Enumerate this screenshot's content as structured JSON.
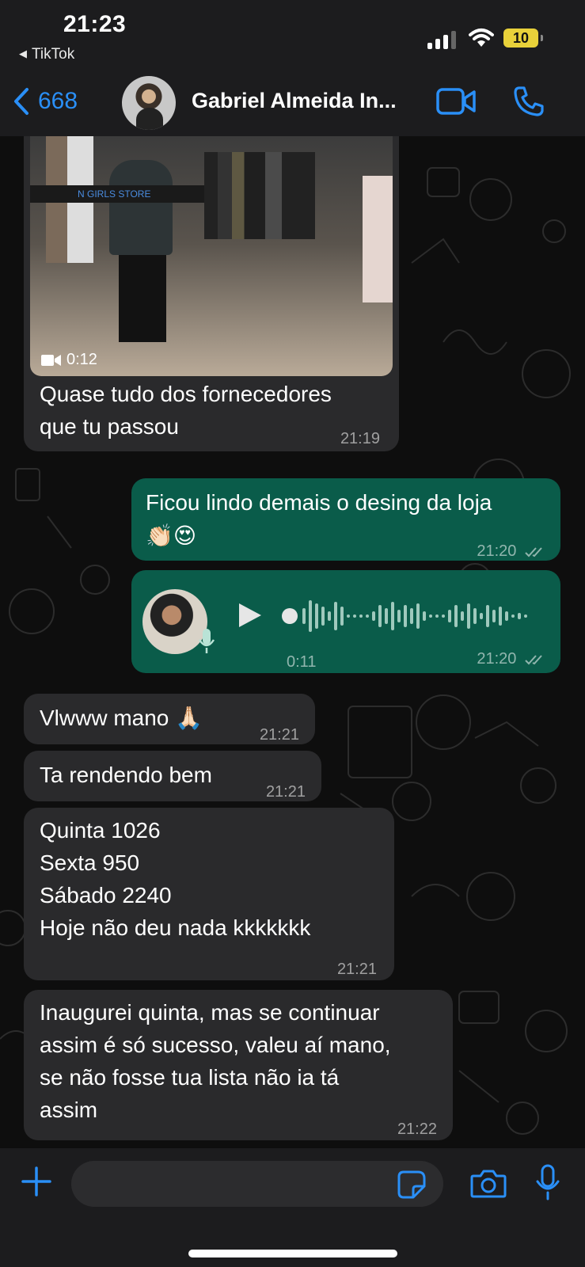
{
  "status_bar": {
    "time": "21:23",
    "back_app": "TikTok",
    "battery": "10"
  },
  "header": {
    "back_count": "668",
    "contact_name": "Gabriel Almeida In..."
  },
  "messages": [
    {
      "type": "video",
      "direction": "incoming",
      "video_duration": "0:12",
      "video_store_sign": "N GIRLS STORE",
      "caption": "Quase tudo dos fornecedores que tu passou",
      "caption_line1": "Quase tudo dos fornecedores",
      "caption_line2": "que tu passou",
      "time": "21:19"
    },
    {
      "type": "text",
      "direction": "outgoing",
      "line1": "Ficou lindo demais o desing da loja",
      "line2": "👏🏻😍",
      "time": "21:20",
      "status": "read"
    },
    {
      "type": "audio",
      "direction": "outgoing",
      "duration": "0:11",
      "time": "21:20",
      "status": "read"
    },
    {
      "type": "text",
      "direction": "incoming",
      "text": "Vlwww mano 🙏🏻",
      "time": "21:21"
    },
    {
      "type": "text",
      "direction": "incoming",
      "text": "Ta rendendo bem",
      "time": "21:21"
    },
    {
      "type": "text",
      "direction": "incoming",
      "lines": [
        "Quinta 1026",
        "Sexta 950",
        "Sábado 2240",
        "Hoje não deu nada kkkkkkk"
      ],
      "time": "21:21"
    },
    {
      "type": "text",
      "direction": "incoming",
      "lines": [
        "Inaugurei quinta, mas se continuar",
        "assim é só sucesso, valeu aí mano,",
        "se não fosse tua lista não ia tá",
        "assim"
      ],
      "time": "21:22"
    }
  ],
  "composer": {
    "input_value": "",
    "input_placeholder": ""
  },
  "colors": {
    "accent": "#2a8ff7",
    "outgoing_bubble": "#0a5c4a",
    "incoming_bubble": "#2a2a2c"
  },
  "icons": [
    "back-chevron-icon",
    "video-call-icon",
    "phone-icon",
    "plus-icon",
    "sticker-icon",
    "camera-icon",
    "mic-icon",
    "play-icon",
    "double-check-icon",
    "video-camera-icon"
  ]
}
